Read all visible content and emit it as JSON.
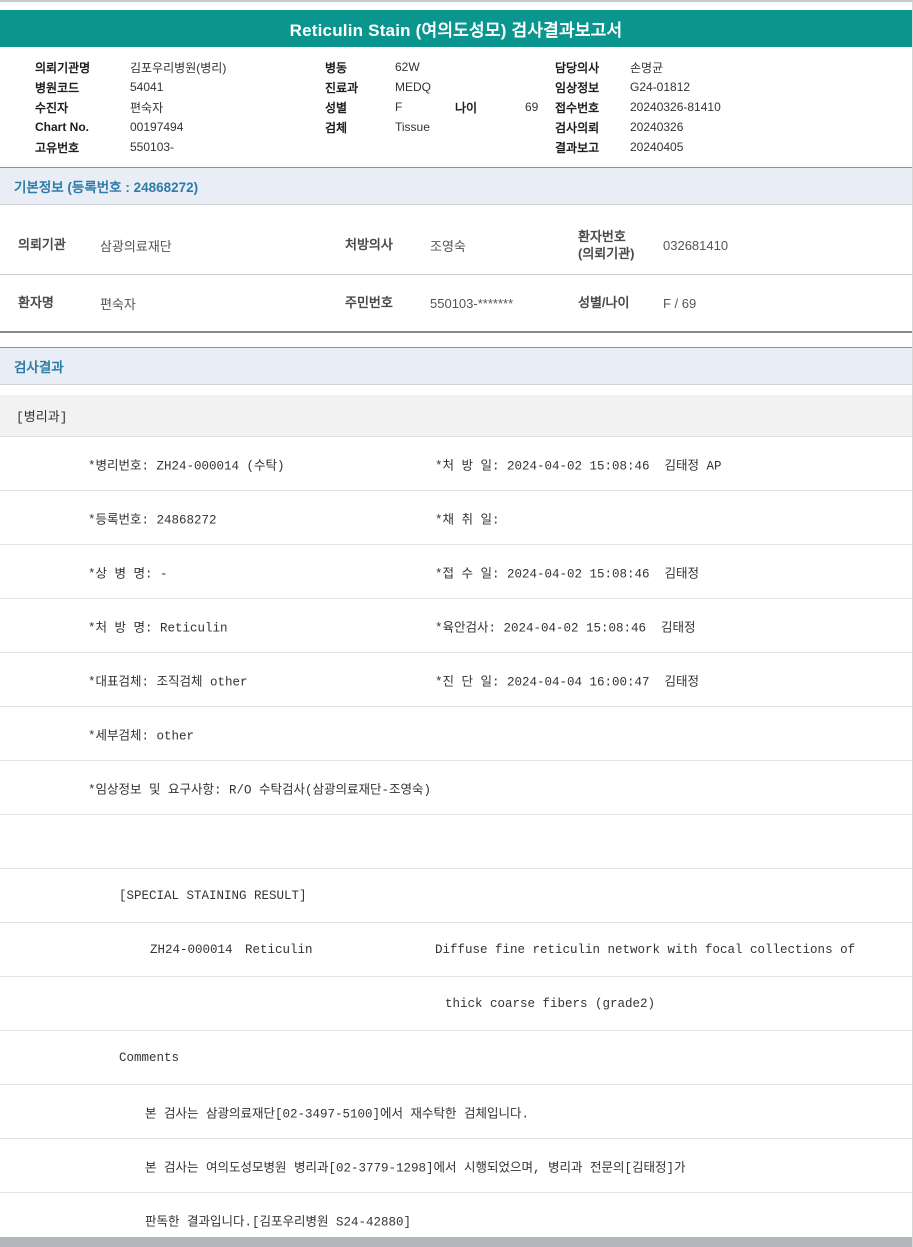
{
  "title": "Reticulin Stain (여의도성모) 검사결과보고서",
  "colors": {
    "banner_bg": "#0a968e",
    "section_bg": "#e9eef6",
    "section_text": "#2e7ca6",
    "footer_bar": "#b3b6ba"
  },
  "header": {
    "left": [
      {
        "label": "의뢰기관명",
        "value": "김포우리병원(병리)"
      },
      {
        "label": "병원코드",
        "value": "54041"
      },
      {
        "label": "수진자",
        "value": "편숙자"
      },
      {
        "label": "Chart No.",
        "value": "00197494"
      },
      {
        "label": "고유번호",
        "value": "550103-"
      }
    ],
    "middle": [
      {
        "label": "병동",
        "value": "62W"
      },
      {
        "label": "진료과",
        "value": "MEDQ"
      },
      {
        "label": "성별",
        "value": "F",
        "label2": "나이",
        "value2": "69"
      },
      {
        "label": "검체",
        "value": "Tissue"
      }
    ],
    "right": [
      {
        "label": "담당의사",
        "value": "손명균"
      },
      {
        "label": "임상정보",
        "value": "G24-01812"
      },
      {
        "label": "접수번호",
        "value": "20240326-81410"
      },
      {
        "label": "검사의뢰",
        "value": "20240326"
      },
      {
        "label": "결과보고",
        "value": "20240405"
      }
    ]
  },
  "basic_info": {
    "section_title": "기본정보 (등록번호 : 24868272)",
    "rows": [
      {
        "cells": [
          {
            "label": "의뢰기관",
            "value": "삼광의료재단"
          },
          {
            "label": "처방의사",
            "value": "조영숙"
          },
          {
            "label": "환자번호\n(의뢰기관)",
            "value": "032681410"
          }
        ]
      },
      {
        "cells": [
          {
            "label": "환자명",
            "value": "편숙자"
          },
          {
            "label": "주민번호",
            "value": "550103-*******"
          },
          {
            "label": "성별/나이",
            "value": "F / 69"
          }
        ]
      }
    ]
  },
  "results": {
    "section_title": "검사결과",
    "department": "[병리과]",
    "rows": [
      {
        "left": "*병리번호: ZH24-000014 (수탁)",
        "right": "*처 방 일: 2024-04-02 15:08:46  김태정 AP"
      },
      {
        "left": "*등록번호: 24868272",
        "right": "*채 취 일:"
      },
      {
        "left": "*상 병 명: -",
        "right": "*접 수 일: 2024-04-02 15:08:46  김태정"
      },
      {
        "left": "*처 방 명: Reticulin",
        "right": "*육안검사: 2024-04-02 15:08:46  김태정"
      },
      {
        "left": "*대표검체: 조직검체 other",
        "right": "*진 단 일: 2024-04-04 16:00:47  김태정"
      },
      {
        "left": "*세부검체: other",
        "right": ""
      },
      {
        "left": "*임상정보 및 요구사항: R/O 수탁검사(삼광의료재단-조영숙)",
        "right": ""
      }
    ],
    "special": {
      "header": "[SPECIAL STAINING RESULT]",
      "code": "ZH24-000014",
      "stain": "Reticulin",
      "result_line1": "Diffuse fine reticulin network with focal collections of",
      "result_line2": "thick coarse fibers (grade2)",
      "comments_label": "Comments",
      "comments": [
        "본 검사는 삼광의료재단[02-3497-5100]에서 재수탁한 검체입니다.",
        "본 검사는 여의도성모병원 병리과[02-3779-1298]에서 시행되었으며, 병리과 전문의[김태정]가",
        "판독한 결과입니다.[김포우리병원 S24-42880]"
      ]
    }
  }
}
